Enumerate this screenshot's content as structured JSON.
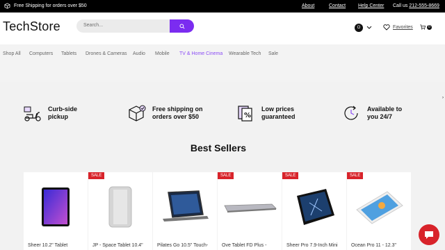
{
  "topbar": {
    "shipping": "Free Shipping for orders over $50",
    "links": [
      "About",
      "Contact",
      "Help Center"
    ],
    "call_label": "Call us",
    "phone": "212-555-8669"
  },
  "header": {
    "logo": "TechStore",
    "search_placeholder": "Search...",
    "account_initial": "O",
    "favorites": "Favorites",
    "cart_count": "0"
  },
  "nav": {
    "items": [
      "Shop All",
      "Computers",
      "Tablets",
      "Drones & Cameras",
      "Audio",
      "Mobile",
      "TV & Home Cinema",
      "Wearable Tech",
      "Sale"
    ],
    "active_index": 6
  },
  "features": [
    {
      "line1": "Curb-side",
      "line2": "pickup",
      "icon": "scooter-icon"
    },
    {
      "line1": "Free shipping on",
      "line2": "orders over $50",
      "icon": "package-icon"
    },
    {
      "line1": "Low prices",
      "line2": "guaranteed",
      "icon": "price-tag-icon"
    },
    {
      "line1": "Available to",
      "line2": "you 24/7",
      "icon": "clock-icon"
    }
  ],
  "best_sellers": "Best Sellers",
  "sale_label": "SALE",
  "products": [
    {
      "name": "Sheer 10.2\" Tablet",
      "sale": false
    },
    {
      "name": "JP - Space Tablet 10.4\"",
      "sale": true
    },
    {
      "name": "Pilates Go 10.5\" Touch-",
      "sale": false
    },
    {
      "name": "Ove Tablet FD Plus -",
      "sale": true
    },
    {
      "name": "Sheer Pro 7.9-Inch Mini",
      "sale": true
    },
    {
      "name": "Ocean Pro 11 - 12.3\"",
      "sale": true
    }
  ],
  "colors": {
    "accent": "#7b2cf0",
    "sale": "#d8232a",
    "active_nav": "#8a4bf5"
  }
}
